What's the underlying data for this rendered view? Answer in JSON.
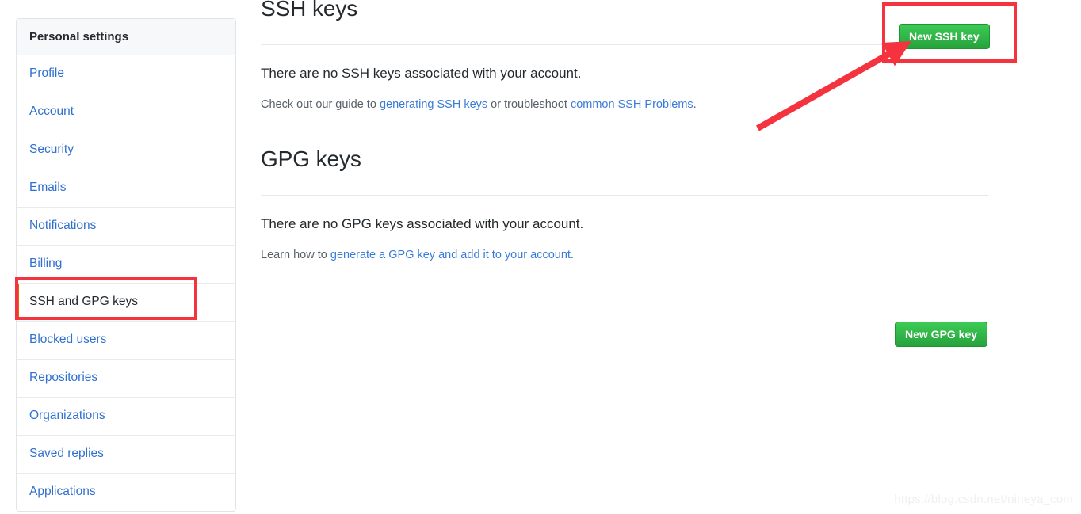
{
  "sidebar": {
    "header": "Personal settings",
    "items": [
      {
        "label": "Profile",
        "selected": false
      },
      {
        "label": "Account",
        "selected": false
      },
      {
        "label": "Security",
        "selected": false
      },
      {
        "label": "Emails",
        "selected": false
      },
      {
        "label": "Notifications",
        "selected": false
      },
      {
        "label": "Billing",
        "selected": false
      },
      {
        "label": "SSH and GPG keys",
        "selected": true
      },
      {
        "label": "Blocked users",
        "selected": false
      },
      {
        "label": "Repositories",
        "selected": false
      },
      {
        "label": "Organizations",
        "selected": false
      },
      {
        "label": "Saved replies",
        "selected": false
      },
      {
        "label": "Applications",
        "selected": false
      }
    ]
  },
  "ssh_section": {
    "title": "SSH keys",
    "button_label": "New SSH key",
    "empty_message": "There are no SSH keys associated with your account.",
    "help_prefix": "Check out our guide to ",
    "help_link_1": "generating SSH keys",
    "help_middle": " or troubleshoot ",
    "help_link_2": "common SSH Problems",
    "help_suffix": "."
  },
  "gpg_section": {
    "title": "GPG keys",
    "button_label": "New GPG key",
    "empty_message": "There are no GPG keys associated with your account.",
    "help_prefix": "Learn how to ",
    "help_link_1": "generate a GPG key and add it to your account",
    "help_suffix": "."
  },
  "watermark": {
    "text": "https://blog.csdn.net/nineya_com"
  },
  "colors": {
    "accent_green": "#2ea44f",
    "link_blue": "#3a7bd8",
    "annotation_red": "#f5333f",
    "selected_marker_orange": "#e36209",
    "sidebar_header_bg": "#f6f8fa",
    "border_gray": "#e1e4e8"
  }
}
